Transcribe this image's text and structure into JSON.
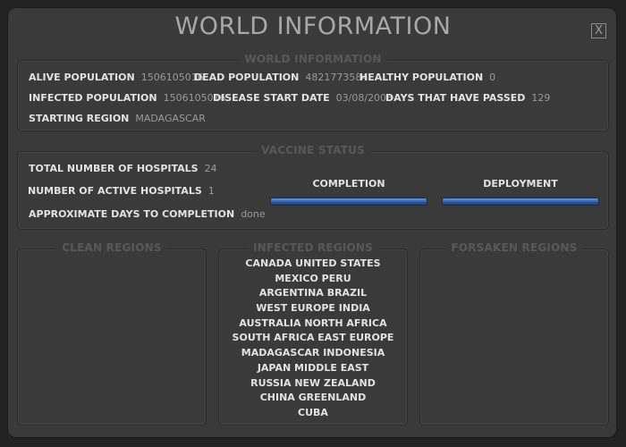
{
  "window": {
    "title": "WORLD INFORMATION",
    "close_label": "X"
  },
  "world": {
    "panel_title": "WORLD INFORMATION",
    "alive_label": "ALIVE POPULATION",
    "alive_value": "1506105016",
    "dead_label": "DEAD POPULATION",
    "dead_value": "4821773584",
    "healthy_label": "HEALTHY POPULATION",
    "healthy_value": "0",
    "infected_label": "INFECTED POPULATION",
    "infected_value": "1506105016",
    "start_label": "DISEASE START DATE",
    "start_value": "03/08/2008",
    "days_label": "DAYS THAT HAVE PASSED",
    "days_value": "129",
    "region_label": "STARTING REGION",
    "region_value": "MADAGASCAR"
  },
  "vaccine": {
    "panel_title": "VACCINE STATUS",
    "hospitals_label": "TOTAL NUMBER OF HOSPITALS",
    "hospitals_value": "24",
    "active_label": "NUMBER OF ACTIVE HOSPITALS",
    "active_value": "1",
    "approx_label": "APPROXIMATE DAYS TO COMPLETION",
    "approx_value": "done",
    "completion_label": "COMPLETION",
    "completion_fraction": 1.0,
    "deployment_label": "DEPLOYMENT",
    "deployment_fraction": 1.0,
    "bar_color": "#2c5aa8"
  },
  "regions": {
    "clean": {
      "title": "CLEAN REGIONS",
      "items": []
    },
    "infected": {
      "title": "INFECTED REGIONS",
      "items": [
        "CANADA  UNITED STATES",
        "MEXICO  PERU",
        "ARGENTINA  BRAZIL",
        "WEST EUROPE  INDIA",
        "AUSTRALIA  NORTH AFRICA",
        "SOUTH AFRICA  EAST EUROPE",
        "MADAGASCAR  INDONESIA",
        "JAPAN  MIDDLE EAST",
        "RUSSIA  NEW ZEALAND",
        "CHINA  GREENLAND",
        "CUBA"
      ]
    },
    "forsaken": {
      "title": "FORSAKEN REGIONS",
      "items": []
    }
  }
}
